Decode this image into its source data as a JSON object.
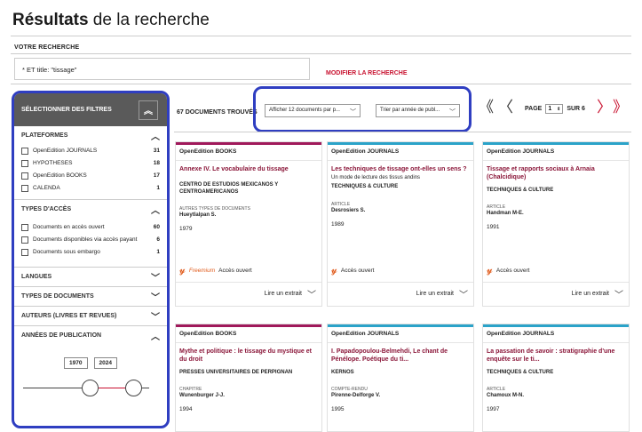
{
  "page_title_bold": "Résultats",
  "page_title_rest": " de la recherche",
  "search": {
    "label": "VOTRE RECHERCHE",
    "value": "* ET title: \"tissage\"",
    "modify": "MODIFIER LA RECHERCHE"
  },
  "sidebar": {
    "header": "SÉLECTIONNER DES FILTRES",
    "sections": {
      "plateformes": "PLATEFORMES",
      "acces": "TYPES D'ACCÈS",
      "langues": "LANGUES",
      "types_docs": "TYPES DE DOCUMENTS",
      "auteurs": "AUTEURS (LIVRES ET REVUES)",
      "annees": "ANNÉES DE PUBLICATION"
    },
    "plateformes": [
      {
        "label": "OpenEdition JOURNALS",
        "count": "31"
      },
      {
        "label": "HYPOTHESES",
        "count": "18"
      },
      {
        "label": "OpenEdition BOOKS",
        "count": "17"
      },
      {
        "label": "CALENDA",
        "count": "1"
      }
    ],
    "acces": [
      {
        "label": "Documents en accès ouvert",
        "count": "60"
      },
      {
        "label": "Documents disponibles via accès payant",
        "count": "6"
      },
      {
        "label": "Documents sous embargo",
        "count": "1"
      }
    ],
    "year_from": "1970",
    "year_to": "2024"
  },
  "results": {
    "count_label": "67 DOCUMENTS TROUVÉS",
    "per_page": "Afficher 12 documents par p...",
    "sort": "Trier par année de publ...",
    "page_label": "PAGE",
    "page_value": "1",
    "page_total": "SUR 6"
  },
  "cards": [
    {
      "pub": "OpenEdition BOOKS",
      "title": "Annexe IV. Le vocabulaire du tissage",
      "subtitle": "",
      "source": "CENTRO DE ESTUDIOS MEXICANOS Y CENTROAMERICANOS",
      "type": "AUTRES TYPES DE DOCUMENTS",
      "author": "Hueytlalpan S.",
      "year": "1979",
      "freemium": "Freemium",
      "access": "Accès ouvert",
      "extract": "Lire un extrait"
    },
    {
      "pub": "OpenEdition JOURNALS",
      "title": "Les techniques de tissage ont-elles un sens ?",
      "subtitle": "Un mode de lecture des tissus andins",
      "source": "TECHNIQUES & CULTURE",
      "type": "ARTICLE",
      "author": "Desrosiers S.",
      "year": "1989",
      "freemium": "",
      "access": "Accès ouvert",
      "extract": "Lire un extrait"
    },
    {
      "pub": "OpenEdition JOURNALS",
      "title": "Tissage et rapports sociaux à Arnaia (Chalcidique)",
      "subtitle": "",
      "source": "TECHNIQUES & CULTURE",
      "type": "ARTICLE",
      "author": "Handman M-E.",
      "year": "1991",
      "freemium": "",
      "access": "Accès ouvert",
      "extract": "Lire un extrait"
    },
    {
      "pub": "OpenEdition BOOKS",
      "title": "Mythe et politique : le tissage du mystique et du droit",
      "subtitle": "",
      "source": "PRESSES UNIVERSITAIRES DE PERPIGNAN",
      "type": "CHAPITRE",
      "author": "Wunenburger J-J.",
      "year": "1994"
    },
    {
      "pub": "OpenEdition JOURNALS",
      "title": "I. Papadopoulou-Belmehdi, Le chant de Pénélope. Poétique du ti...",
      "subtitle": "",
      "source": "KERNOS",
      "type": "COMPTE-RENDU",
      "author": "Pirenne-Delforge V.",
      "year": "1995"
    },
    {
      "pub": "OpenEdition JOURNALS",
      "title": "La passation de savoir : stratigraphie d'une enquête sur le ti...",
      "subtitle": "",
      "source": "TECHNIQUES & CULTURE",
      "type": "ARTICLE",
      "author": "Chamoux M-N.",
      "year": "1997"
    }
  ],
  "colors": {
    "books": "#a0195b",
    "journals": "#2ba3c9",
    "accent": "#c8102e",
    "highlight": "#2f3ec1"
  }
}
